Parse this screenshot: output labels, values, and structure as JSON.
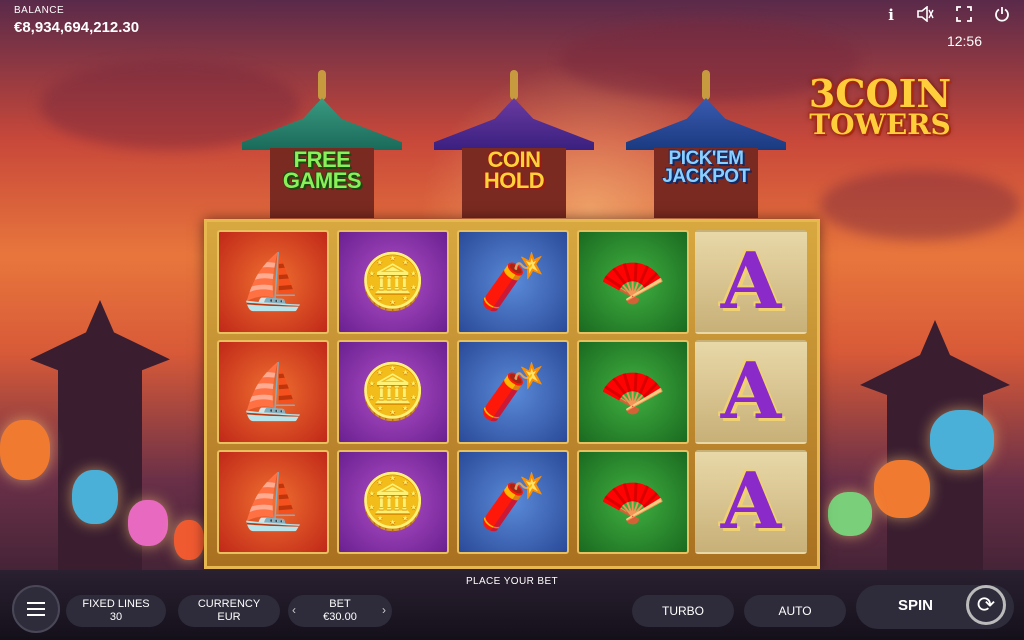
{
  "hud": {
    "balance_label": "BALANCE",
    "balance_value": "€8,934,694,212.30",
    "time": "12:56",
    "icons": [
      "info-icon",
      "sound-icon",
      "fullscreen-icon",
      "power-icon"
    ]
  },
  "logo": {
    "line1": "3COIN",
    "line2": "TOWERS"
  },
  "towers": [
    {
      "line1": "FREE",
      "line2": "GAMES"
    },
    {
      "line1": "COIN",
      "line2": "HOLD"
    },
    {
      "line1": "PICK'EM",
      "line2": "JACKPOT"
    }
  ],
  "reels": [
    {
      "symbol": "golden-ship",
      "glyph": "⛵",
      "bg": "red"
    },
    {
      "symbol": "gold-coins",
      "glyph": "🪙",
      "bg": "purple"
    },
    {
      "symbol": "firecrackers",
      "glyph": "🧨",
      "bg": "blue"
    },
    {
      "symbol": "red-fan",
      "glyph": "🪭",
      "bg": "green"
    },
    {
      "symbol": "letter-a",
      "glyph": "A",
      "bg": "gold"
    }
  ],
  "footer": {
    "place_bet": "PLACE YOUR BET",
    "fixed_lines_label": "FIXED LINES",
    "fixed_lines_value": "30",
    "currency_label": "CURRENCY",
    "currency_value": "EUR",
    "bet_label": "BET",
    "bet_value": "€30.00",
    "turbo": "TURBO",
    "auto": "AUTO",
    "spin": "SPIN"
  },
  "colors": {
    "reel_frame": "#d8a840",
    "panel": "#2e2c3a"
  }
}
